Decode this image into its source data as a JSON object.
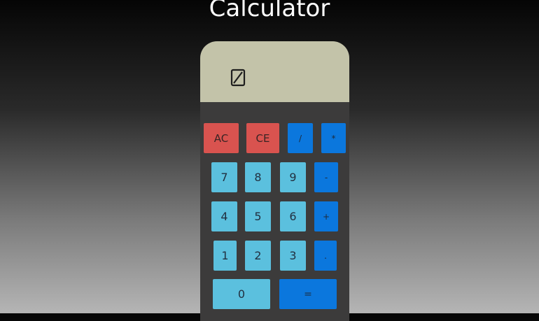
{
  "page": {
    "title": "Calculator"
  },
  "display": {
    "value": ""
  },
  "keys": {
    "ac": "AC",
    "ce": "CE",
    "divide": "/",
    "multiply": "*",
    "seven": "7",
    "eight": "8",
    "nine": "9",
    "minus": "-",
    "four": "4",
    "five": "5",
    "six": "6",
    "plus": "+",
    "one": "1",
    "two": "2",
    "three": "3",
    "decimal": ".",
    "zero": "0",
    "equals": "="
  },
  "colors": {
    "display_background": "#c3c3a9",
    "body_background": "#3c3b3b",
    "clear_keys": "#d9534f",
    "number_keys": "#5bc0de",
    "operator_keys": "#0b77dd"
  }
}
